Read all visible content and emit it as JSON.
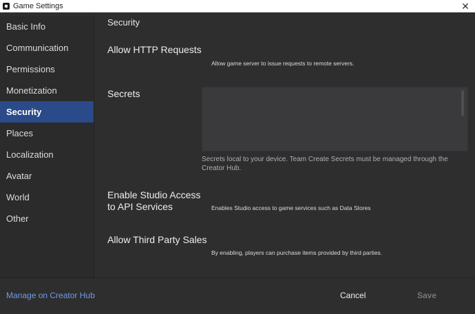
{
  "window": {
    "title": "Game Settings",
    "close_glyph": "✕"
  },
  "sidebar": {
    "items": [
      {
        "label": "Basic Info"
      },
      {
        "label": "Communication"
      },
      {
        "label": "Permissions"
      },
      {
        "label": "Monetization"
      },
      {
        "label": "Security",
        "active": true
      },
      {
        "label": "Places"
      },
      {
        "label": "Localization"
      },
      {
        "label": "Avatar"
      },
      {
        "label": "World"
      },
      {
        "label": "Other"
      }
    ]
  },
  "main": {
    "section_title": "Security",
    "settings": {
      "http": {
        "label": "Allow HTTP Requests",
        "description": "Allow game server to issue requests to remote servers."
      },
      "secrets": {
        "label": "Secrets",
        "value": "",
        "hint": "Secrets local to your device. Team Create Secrets must be managed through the Creator Hub."
      },
      "studio_api": {
        "label": "Enable Studio Access to API Services",
        "description": "Enables Studio access to game services such as Data Stores"
      },
      "third_party": {
        "label": "Allow Third Party Sales",
        "description": "By enabling, players can purchase items provided by third parties."
      }
    }
  },
  "footer": {
    "creator_hub_link": "Manage on Creator Hub",
    "cancel_label": "Cancel",
    "save_label": "Save"
  },
  "colors": {
    "accent": "#2a4a8a",
    "link": "#6f9be8",
    "background": "#2e2e2e"
  }
}
